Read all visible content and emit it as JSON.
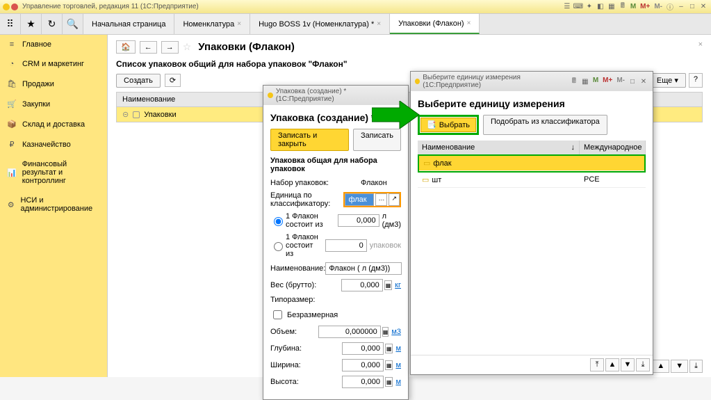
{
  "app": {
    "title": "Управление торговлей, редакция 11   (1С:Предприятие)"
  },
  "tabs": {
    "start": "Начальная страница",
    "nomen": "Номенклатура",
    "hugo": "Hugo BOSS 1v (Номенклатура) *",
    "pack": "Упаковки (Флакон)"
  },
  "sidebar": {
    "main": "Главное",
    "crm": "CRM и маркетинг",
    "sales": "Продажи",
    "purchase": "Закупки",
    "warehouse": "Склад и доставка",
    "treasury": "Казначейство",
    "finresult": "Финансовый результат и контроллинг",
    "nsi": "НСИ и администрирование"
  },
  "content": {
    "title": "Упаковки (Флакон)",
    "list_title": "Список упаковок общий для набора упаковок \"Флакон\"",
    "create": "Создать",
    "more": "Еще",
    "col_name": "Наименование",
    "row1": "Упаковки"
  },
  "dlg1": {
    "wintitle": "Упаковка (создание) *   (1С:Предприятие)",
    "title": "Упаковка (создание) *",
    "save_close": "Записать и закрыть",
    "save": "Записать",
    "subheading": "Упаковка общая для набора упаковок",
    "set_label": "Набор упаковок:",
    "set_value": "Флакон",
    "unit_label": "Единица по классификатору:",
    "unit_value": "флак",
    "radio1_prefix": "1 Флакон состоит из",
    "radio1_unit": "л (дм3)",
    "radio2_prefix": "1 Флакон состоит из",
    "radio2_unit": "упаковок",
    "name_label": "Наименование:",
    "name_value": "Флакон ( л (дм3))",
    "weight_label": "Вес (брутто):",
    "weight_value": "0,000",
    "weight_unit": "кг",
    "typesize_label": "Типоразмер:",
    "dimless": "Безразмерная",
    "volume_label": "Объем:",
    "volume_value": "0,000000",
    "volume_unit": "м3",
    "depth_label": "Глубина:",
    "depth_value": "0,000",
    "width_label": "Ширина:",
    "width_value": "0,000",
    "height_label": "Высота:",
    "height_value": "0,000",
    "len_unit": "м",
    "zero3": "0,000",
    "zero1": "0"
  },
  "dlg2": {
    "wintitle": "Выберите единицу измерения   (1С:Предприятие)",
    "title": "Выберите единицу измерения",
    "select": "Выбрать",
    "pick": "Подобрать из классификатора",
    "col_name": "Наименование",
    "col_intl": "Международное",
    "row1_name": "флак",
    "row2_name": "шт",
    "row2_intl": "PCE"
  },
  "marks": {
    "m": "M",
    "mp": "M+",
    "mm": "M-"
  }
}
